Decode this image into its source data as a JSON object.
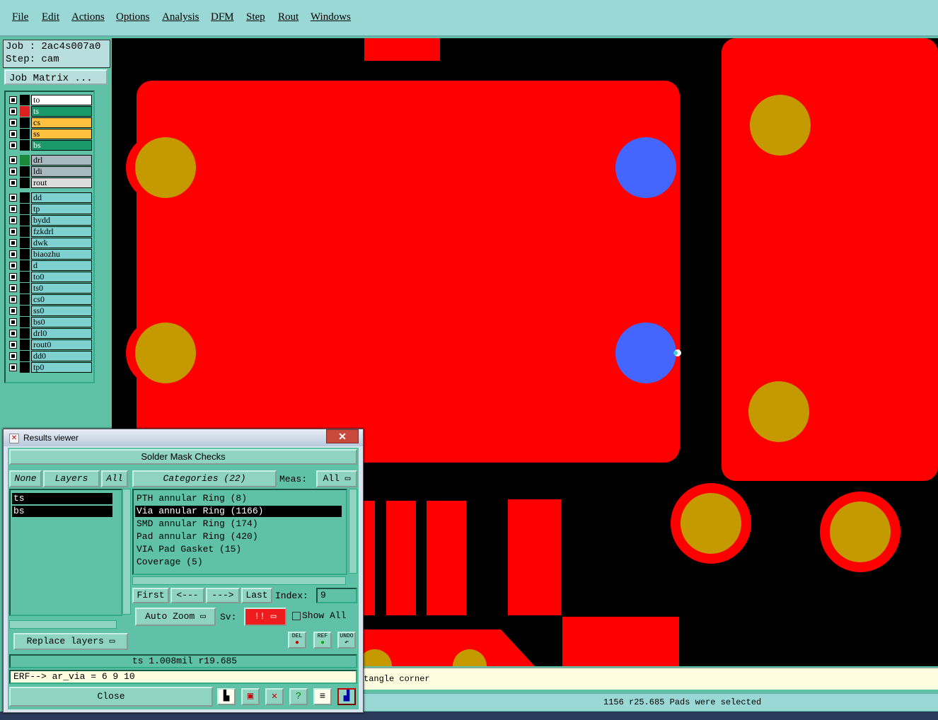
{
  "menu": [
    "File",
    "Edit",
    "Actions",
    "Options",
    "Analysis",
    "DFM",
    "Step",
    "Rout",
    "Windows"
  ],
  "job": {
    "job_line": "Job : 2ac4s007a0",
    "step_line": "Step: cam",
    "matrix_label": "Job Matrix ..."
  },
  "layers": [
    {
      "name": "to",
      "color": "#ffffff",
      "swatch": "#000000",
      "mark": "✐"
    },
    {
      "name": "ts",
      "color": "#1a9a6a",
      "swatch": "#e02020",
      "mark": ""
    },
    {
      "name": "cs",
      "color": "#ffc040",
      "swatch": "#000000",
      "mark": "✐"
    },
    {
      "name": "ss",
      "color": "#ffc040",
      "swatch": "#000000",
      "mark": "✐"
    },
    {
      "name": "bs",
      "color": "#1a9a6a",
      "swatch": "#000000",
      "mark": ""
    },
    {
      "name": "drl",
      "color": "#a8b8c0",
      "swatch": "#1a8a3a",
      "mark": "▦"
    },
    {
      "name": "ldi",
      "color": "#a8b8c0",
      "swatch": "#000000",
      "mark": ""
    },
    {
      "name": "rout",
      "color": "#dcdcdc",
      "swatch": "#000000",
      "mark": ""
    },
    {
      "name": "dd",
      "color": "#7fd0d0",
      "swatch": "#000000",
      "mark": ""
    },
    {
      "name": "tp",
      "color": "#7fd0d0",
      "swatch": "#000000",
      "mark": ""
    },
    {
      "name": "bydd",
      "color": "#7fd0d0",
      "swatch": "#000000",
      "mark": ""
    },
    {
      "name": "fzkdrl",
      "color": "#7fd0d0",
      "swatch": "#000000",
      "mark": ""
    },
    {
      "name": "dwk",
      "color": "#7fd0d0",
      "swatch": "#000000",
      "mark": ""
    },
    {
      "name": "biaozhu",
      "color": "#7fd0d0",
      "swatch": "#000000",
      "mark": ""
    },
    {
      "name": "d",
      "color": "#7fd0d0",
      "swatch": "#000000",
      "mark": ""
    },
    {
      "name": "to0",
      "color": "#7fd0d0",
      "swatch": "#000000",
      "mark": "✐"
    },
    {
      "name": "ts0",
      "color": "#7fd0d0",
      "swatch": "#000000",
      "mark": ""
    },
    {
      "name": "cs0",
      "color": "#7fd0d0",
      "swatch": "#000000",
      "mark": "✐"
    },
    {
      "name": "ss0",
      "color": "#7fd0d0",
      "swatch": "#000000",
      "mark": "✐"
    },
    {
      "name": "bs0",
      "color": "#7fd0d0",
      "swatch": "#000000",
      "mark": ""
    },
    {
      "name": "drl0",
      "color": "#7fd0d0",
      "swatch": "#000000",
      "mark": ""
    },
    {
      "name": "rout0",
      "color": "#7fd0d0",
      "swatch": "#000000",
      "mark": ""
    },
    {
      "name": "dd0",
      "color": "#7fd0d0",
      "swatch": "#000000",
      "mark": ""
    },
    {
      "name": "tp0",
      "color": "#7fd0d0",
      "swatch": "#000000",
      "mark": ""
    }
  ],
  "bottom_message": "tangle corner",
  "status_message": "1156 r25.685 Pads were selected",
  "results_viewer": {
    "title": "Results viewer",
    "close_x": "✕",
    "header": "Solder Mask Checks",
    "none_btn": "None",
    "layers_btn": "Layers",
    "all_btn": "All",
    "categories_btn": "Categories (22)",
    "meas_label": "Meas:",
    "meas_value": "All",
    "layer_items": [
      "ts",
      "bs"
    ],
    "category_items": [
      "PTH annular Ring (8)",
      "Via annular Ring (1166)",
      "SMD annular Ring (174)",
      "Pad annular Ring (420)",
      "VIA Pad Gasket (15)",
      "Coverage (5)"
    ],
    "selected_category": 1,
    "first_btn": "First",
    "prev_btn": "<---",
    "next_btn": "--->",
    "last_btn": "Last",
    "index_label": "Index:",
    "index_value": "9",
    "autozoom": "Auto Zoom",
    "sv_label": "Sv:",
    "sv_value": "!!",
    "show_all": "Show All",
    "replace_layers": "Replace layers",
    "del_btn": "DEL",
    "ref_btn": "REF",
    "undo_btn": "UNDO",
    "info_line": "ts 1.008mil  r19.685",
    "erf_line": "ERF--> ar_via = 6 9 10",
    "close_btn": "Close"
  },
  "colors": {
    "copper": "#ff0000",
    "pad": "#c49a00",
    "via": "#4466ff",
    "background": "#000000"
  }
}
